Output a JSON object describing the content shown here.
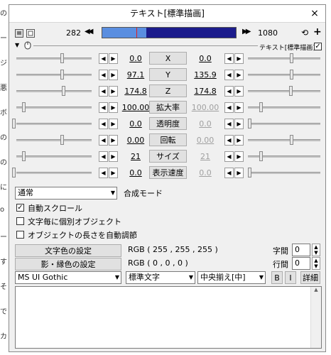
{
  "window": {
    "title": "テキスト[標準描画]",
    "close_glyph": "×"
  },
  "toolbar": {
    "frame_start": "282",
    "frame_end": "1080",
    "prev_glyph": "◀◀",
    "next_glyph": "▶▶",
    "timeline_progress": 0.33,
    "loop_glyph": "⟲",
    "add_glyph": "+"
  },
  "subheader": {
    "filter_label": "テキスト[標準描画]",
    "checked": true
  },
  "params": [
    {
      "name": "X",
      "left": "0.0",
      "right": "0.0",
      "left_dim": false,
      "right_dim": false
    },
    {
      "name": "Y",
      "left": "97.1",
      "right": "135.9",
      "left_dim": false,
      "right_dim": false
    },
    {
      "name": "Z",
      "left": "174.8",
      "right": "174.8",
      "left_dim": false,
      "right_dim": false
    },
    {
      "name": "拡大率",
      "left": "100.00",
      "right": "100.00",
      "left_dim": false,
      "right_dim": true
    },
    {
      "name": "透明度",
      "left": "0.0",
      "right": "0.0",
      "left_dim": false,
      "right_dim": true
    },
    {
      "name": "回転",
      "left": "0.00",
      "right": "0.00",
      "left_dim": false,
      "right_dim": true
    },
    {
      "name": "サイズ",
      "left": "21",
      "right": "21",
      "left_dim": false,
      "right_dim": true
    },
    {
      "name": "表示速度",
      "left": "0.0",
      "right": "0.0",
      "left_dim": false,
      "right_dim": true
    }
  ],
  "blend": {
    "value": "通常",
    "label": "合成モード"
  },
  "options": [
    {
      "label": "自動スクロール",
      "checked": true
    },
    {
      "label": "文字毎に個別オブジェクト",
      "checked": false
    },
    {
      "label": "オブジェクトの長さを自動調節",
      "checked": false
    }
  ],
  "colors": {
    "text_color_button": "文字色の設定",
    "text_color_value": "RGB ( 255 , 255 , 255 )",
    "shadow_color_button": "影・縁色の設定",
    "shadow_color_value": "RGB ( 0 , 0 , 0 )"
  },
  "spacing": {
    "char_label": "字間",
    "char_value": "0",
    "line_label": "行間",
    "line_value": "0"
  },
  "font": {
    "family": "MS UI Gothic",
    "style": "標準文字",
    "align": "中央揃え[中]",
    "bold": "B",
    "italic": "I",
    "details": "詳細"
  },
  "background": {
    "glyphs": [
      "の",
      "ー",
      "ジ",
      "悪",
      "ボ",
      "の",
      "の",
      "に",
      "o",
      "ー",
      "す",
      "そ",
      "で",
      "カ"
    ]
  }
}
